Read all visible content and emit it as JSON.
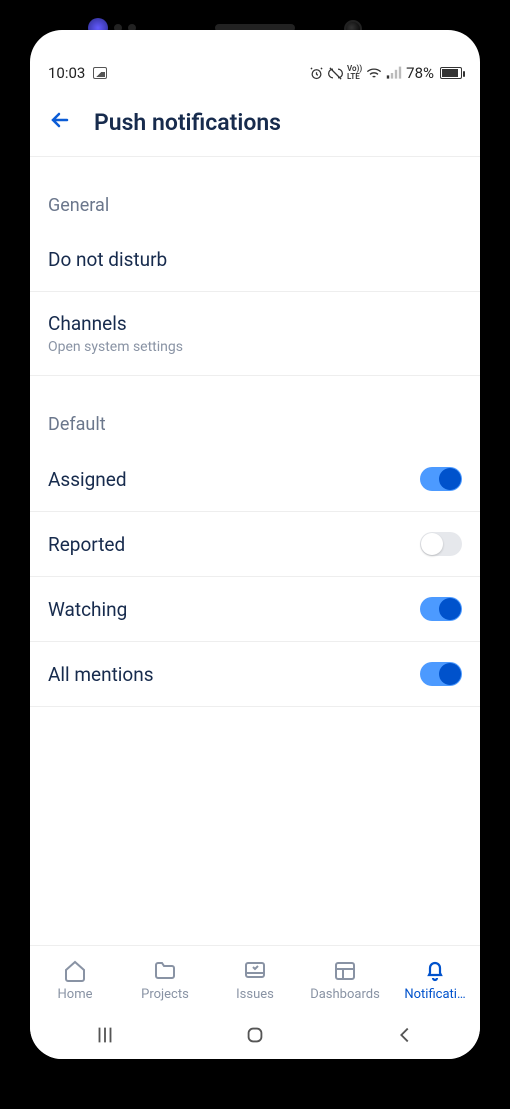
{
  "status": {
    "time": "10:03",
    "battery_pct": "78%",
    "indicators": [
      "alarm",
      "vibrate",
      "volte",
      "wifi",
      "signal"
    ]
  },
  "header": {
    "title": "Push notifications"
  },
  "sections": {
    "general": {
      "title": "General",
      "dnd": {
        "label": "Do not disturb"
      },
      "channels": {
        "label": "Channels",
        "sub": "Open system settings"
      }
    },
    "default": {
      "title": "Default",
      "items": [
        {
          "label": "Assigned",
          "on": true
        },
        {
          "label": "Reported",
          "on": false
        },
        {
          "label": "Watching",
          "on": true
        },
        {
          "label": "All mentions",
          "on": true
        }
      ]
    }
  },
  "nav": {
    "items": [
      {
        "label": "Home",
        "icon": "home"
      },
      {
        "label": "Projects",
        "icon": "folder"
      },
      {
        "label": "Issues",
        "icon": "tray"
      },
      {
        "label": "Dashboards",
        "icon": "dashboard"
      },
      {
        "label": "Notificati…",
        "icon": "bell",
        "active": true
      }
    ]
  }
}
